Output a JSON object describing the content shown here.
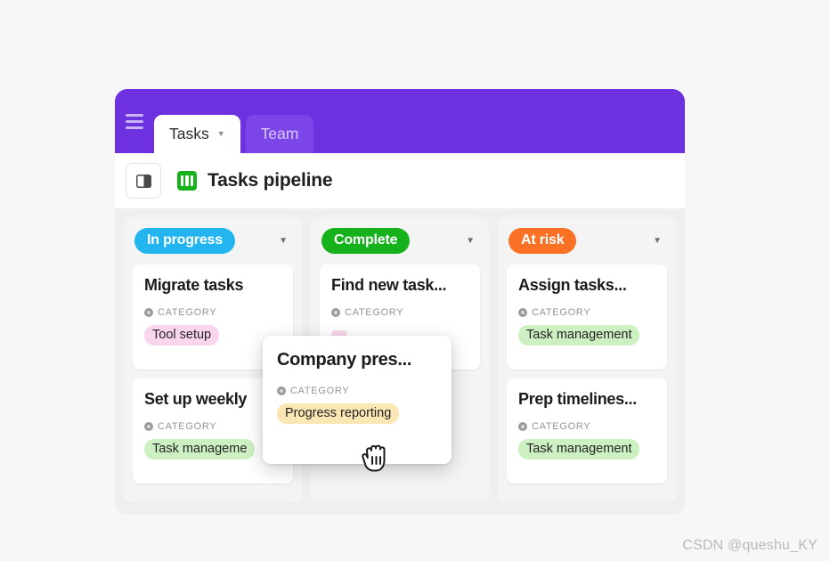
{
  "window": {
    "menu_icon": "hamburger-icon",
    "tabs": [
      {
        "label": "Tasks",
        "active": true,
        "caret": "▼"
      },
      {
        "label": "Team",
        "active": false
      }
    ]
  },
  "toolbar": {
    "sidebar_toggle_icon": "sidebar-toggle-icon",
    "board_icon": "kanban-board-icon",
    "title": "Tasks pipeline"
  },
  "board": {
    "caret": "▼",
    "meta_label": "CATEGORY",
    "columns": [
      {
        "status": "In progress",
        "status_color": "#23b5f0",
        "cards": [
          {
            "title": "Migrate tasks",
            "meta_label": "CATEGORY",
            "tag": "Tool setup",
            "tag_bg": "#f9d6ed",
            "tag_color": "#232323"
          },
          {
            "title": "Set up weekly",
            "meta_label": "CATEGORY",
            "tag": "Task manageme",
            "tag_bg": "#ccf0c2",
            "tag_color": "#232323"
          }
        ]
      },
      {
        "status": "Complete",
        "status_color": "#16b21c",
        "cards": [
          {
            "title": "Find new task...",
            "meta_label": "CATEGORY",
            "tag": "",
            "tag_bg": "#f9d6ed",
            "tag_color": "#232323"
          }
        ]
      },
      {
        "status": "At risk",
        "status_color": "#fa7024",
        "cards": [
          {
            "title": "Assign tasks...",
            "meta_label": "CATEGORY",
            "tag": "Task management",
            "tag_bg": "#ccf0c2",
            "tag_color": "#232323"
          },
          {
            "title": "Prep timelines...",
            "meta_label": "CATEGORY",
            "tag": "Task management",
            "tag_bg": "#ccf0c2",
            "tag_color": "#232323"
          }
        ]
      }
    ]
  },
  "dragged_card": {
    "title": "Company pres...",
    "meta_label": "CATEGORY",
    "tag": "Progress reporting",
    "tag_bg": "#fbe7b4",
    "tag_color": "#232323",
    "cursor_icon": "grab-hand-cursor"
  },
  "watermark": "CSDN @queshu_KY",
  "colors": {
    "brand_purple": "#6d31e0",
    "tab_inactive_purple": "#7b45e8",
    "page_background": "#f7f7f7",
    "board_background": "#efefef"
  }
}
